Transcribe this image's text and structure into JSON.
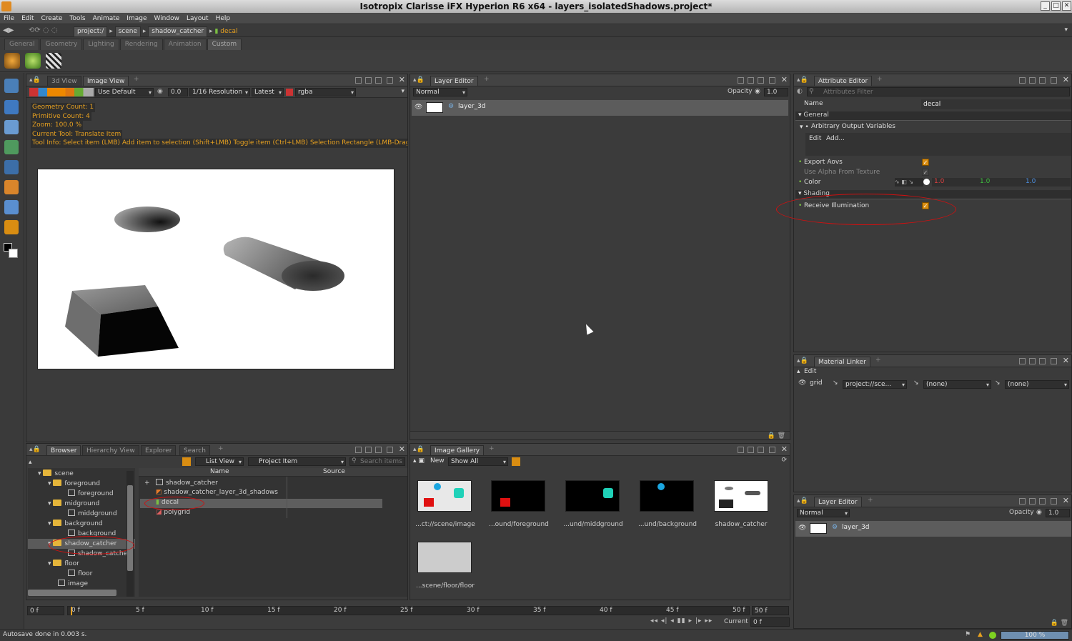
{
  "window": {
    "title": "Isotropix Clarisse iFX Hyperion R6 x64  - layers_isolatedShadows.project*"
  },
  "menu": [
    "File",
    "Edit",
    "Create",
    "Tools",
    "Animate",
    "Image",
    "Window",
    "Layout",
    "Help"
  ],
  "address": {
    "crumbs": [
      "project:/",
      "scene",
      "shadow_catcher"
    ],
    "current": "decal"
  },
  "shelf_tabs": [
    "General",
    "Geometry",
    "Lighting",
    "Rendering",
    "Animation",
    "Custom"
  ],
  "viewer": {
    "tabs": [
      "3d View",
      "Image View"
    ],
    "display_mode": "Use Default",
    "exposure": "0.0",
    "resolution": "1/16 Resolution",
    "layer": "Latest",
    "channels": "rgba",
    "info": [
      "Geometry Count: 1",
      "Primitive Count: 4",
      "Zoom: 100.0 %",
      "Current Tool: Translate Item",
      "Tool Info: Select item (LMB)  Add item to selection (Shift+LMB)  Toggle item (Ctrl+LMB)  Selection Rectangle (LMB-Drag"
    ]
  },
  "layer_editor_main": {
    "tab": "Layer Editor",
    "blend_mode": "Normal",
    "opacity_label": "Opacity",
    "opacity_value": "1.0",
    "layers": [
      "layer_3d"
    ]
  },
  "attribute_editor": {
    "tab": "Attribute Editor",
    "filter_placeholder": "Attributes Filter",
    "name_label": "Name",
    "name_value": "decal",
    "group_general": "General",
    "aov_label": "Arbitrary Output Variables",
    "aov_edit": "Edit",
    "aov_add": "Add...",
    "export_aovs": "Export Aovs",
    "use_alpha": "Use Alpha From Texture",
    "color_label": "Color",
    "color_r": "1.0",
    "color_g": "1.0",
    "color_b": "1.0",
    "group_shading": "Shading",
    "receive_illum": "Receive Illumination",
    "receive_illum_on": true,
    "export_aovs_on": true
  },
  "material_linker": {
    "tab": "Material Linker",
    "edit": "Edit",
    "item": "grid",
    "material": "project://sce...",
    "clip": "(none)",
    "displacement": "(none)"
  },
  "layer_editor_small": {
    "tab": "Layer Editor",
    "blend_mode": "Normal",
    "opacity_label": "Opacity",
    "opacity_value": "1.0",
    "layers": [
      "layer_3d"
    ]
  },
  "browser": {
    "tabs": [
      "Browser",
      "Hierarchy View",
      "Explorer",
      "Search"
    ],
    "view_mode": "List View",
    "filter": "Project Item",
    "search_placeholder": "Search items",
    "tree": [
      "scene",
      "foreground",
      "foreground",
      "midground",
      "middground",
      "background",
      "background",
      "shadow_catcher",
      "shadow_catcher",
      "floor",
      "floor",
      "image"
    ],
    "col_name": "Name",
    "col_source": "Source",
    "items": [
      "shadow_catcher",
      "shadow_catcher_layer_3d_shadows",
      "decal",
      "polygrid"
    ]
  },
  "gallery": {
    "tab": "Image Gallery",
    "new_label": "New",
    "show": "Show All",
    "thumbs": [
      "...ct://scene/image",
      "...ound/foreground",
      "...und/middground",
      "...und/background",
      "shadow_catcher",
      "...scene/floor/floor"
    ]
  },
  "timeline": {
    "start": "0 f",
    "end": "50 f",
    "ticks": [
      "0 f",
      "5 f",
      "10 f",
      "15 f",
      "20 f",
      "25 f",
      "30 f",
      "35 f",
      "40 f",
      "45 f",
      "50 f"
    ],
    "current_label": "Current",
    "current_value": "0 f"
  },
  "status": {
    "message": "Autosave done in 0.003 s.",
    "progress": "100 %"
  }
}
